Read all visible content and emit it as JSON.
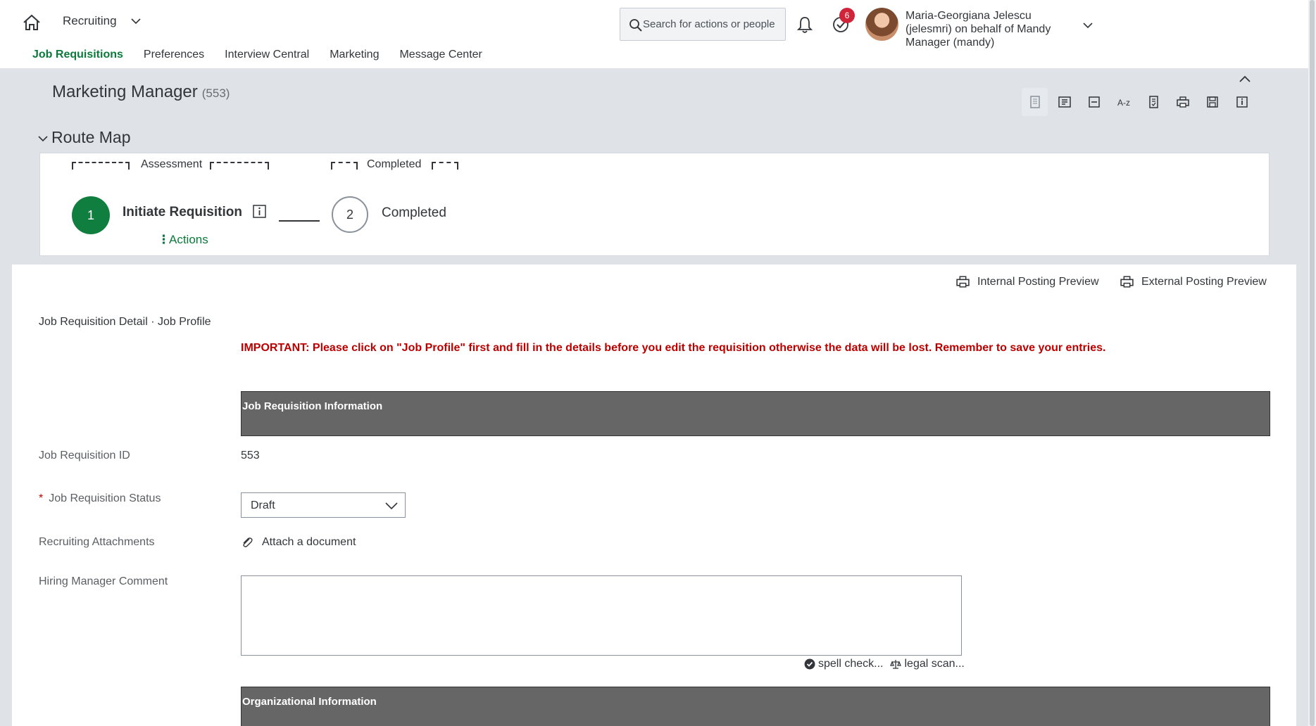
{
  "shell": {
    "module": "Recruiting",
    "search_placeholder": "Search for actions or people",
    "todo_badge": "6",
    "user_line1": "Maria-Georgiana Jelescu",
    "user_line2": "(jelesmri) on behalf of Mandy",
    "user_line3": "Manager (mandy)",
    "nav": [
      "Job Requisitions",
      "Preferences",
      "Interview Central",
      "Marketing",
      "Message Center"
    ]
  },
  "page": {
    "title": "Marketing Manager",
    "count": "(553)"
  },
  "route_map": {
    "title": "Route Map",
    "stage_a": "Assessment",
    "stage_b": "Completed",
    "step1_number": "1",
    "step1_label": "Initiate Requisition",
    "step2_number": "2",
    "step2_label": "Completed",
    "actions_label": "Actions"
  },
  "preview": {
    "internal": "Internal Posting Preview",
    "external": "External Posting Preview"
  },
  "form": {
    "crumb": "Job Requisition Detail · Job Profile",
    "important": "IMPORTANT: Please click on \"Job Profile\" first and fill in the details before you edit the requisition otherwise the data will be lost. Remember to save your entries.",
    "section1": "Job Requisition Information",
    "id_label": "Job Requisition ID",
    "id_value": "553",
    "status_label": "Job Requisition Status",
    "status_value": "Draft",
    "attachments_label": "Recruiting Attachments",
    "attach_link": "Attach a document",
    "comment_label": "Hiring Manager Comment",
    "spell_check": "spell check...",
    "legal_scan": "legal scan...",
    "section2": "Organizational Information"
  },
  "colors": {
    "accent": "#0a7a3b",
    "step_active": "#107e3e",
    "warning": "#bb0000",
    "band": "#666666",
    "badge": "#d0243a"
  }
}
